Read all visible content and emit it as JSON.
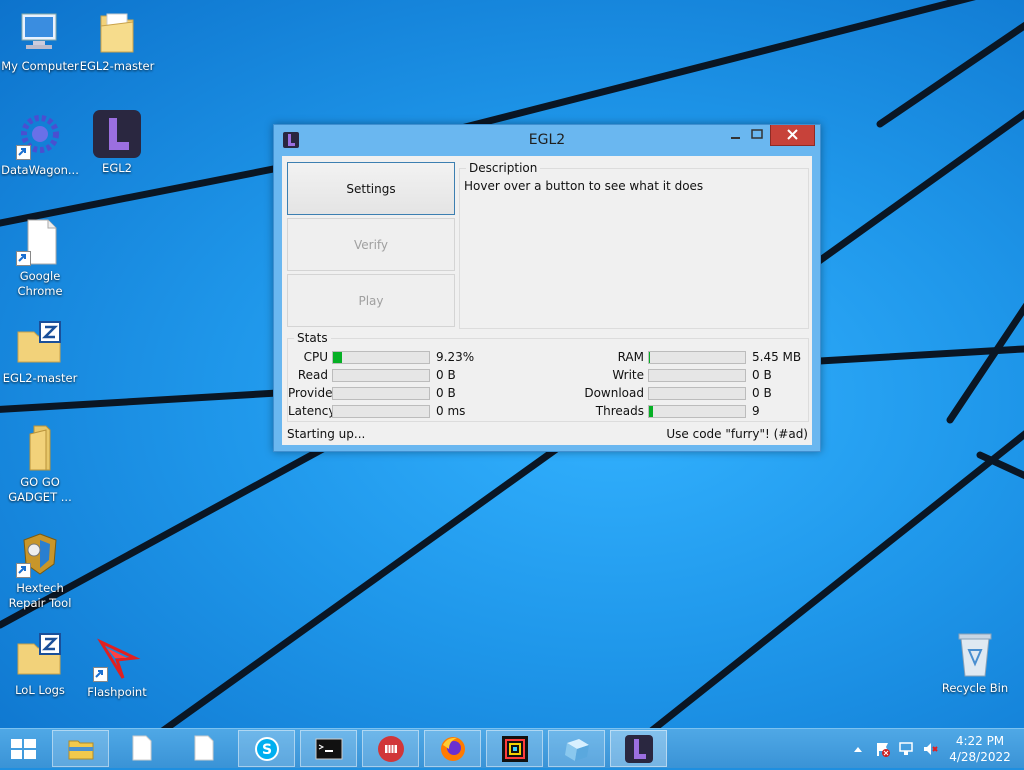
{
  "desktop": {
    "icons": {
      "my_computer": "My Computer",
      "egl2_master_folder": "EGL2-master",
      "datawagon": "DataWagon...",
      "egl2": "EGL2",
      "chrome_line1": "Google",
      "chrome_line2": "Chrome",
      "egl2_master_zip": "EGL2-master",
      "gogo_line1": "GO GO",
      "gogo_line2": "GADGET ...",
      "hextech_line1": "Hextech",
      "hextech_line2": "Repair Tool",
      "lol_logs": "LoL Logs",
      "flashpoint": "Flashpoint",
      "recycle_bin": "Recycle Bin"
    }
  },
  "window": {
    "title": "EGL2",
    "buttons": {
      "settings": "Settings",
      "verify": "Verify",
      "play": "Play"
    },
    "description": {
      "title": "Description",
      "text": "Hover over a button to see what it does"
    },
    "stats": {
      "title": "Stats",
      "left": [
        {
          "label": "CPU",
          "value": "9.23%",
          "fill": 0.0923
        },
        {
          "label": "Read",
          "value": "0 B",
          "fill": 0
        },
        {
          "label": "Provide",
          "value": "0 B",
          "fill": 0
        },
        {
          "label": "Latency",
          "value": "0 ms",
          "fill": 0
        }
      ],
      "right": [
        {
          "label": "RAM",
          "value": "5.45 MB",
          "fill": 0.01
        },
        {
          "label": "Write",
          "value": "0 B",
          "fill": 0
        },
        {
          "label": "Download",
          "value": "0 B",
          "fill": 0
        },
        {
          "label": "Threads",
          "value": "9",
          "fill": 0.045
        }
      ]
    },
    "status_left": "Starting up...",
    "status_right": "Use code \"furry\"! (#ad)"
  },
  "taskbar": {
    "clock_time": "4:22 PM",
    "clock_date": "4/28/2022"
  },
  "colors": {
    "accent": "#3a93d6",
    "progress": "#06b025",
    "close": "#c7423a"
  }
}
